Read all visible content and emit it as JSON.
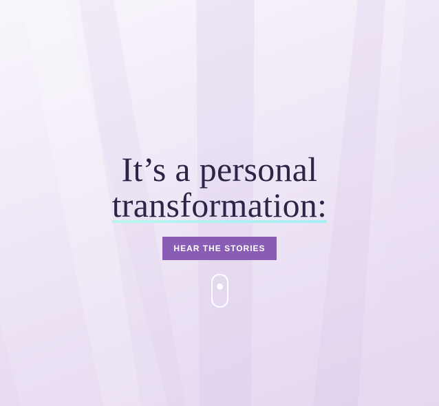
{
  "hero": {
    "headline_line1": "It’s a personal",
    "headline_line2": "transformation:",
    "cta_label": "HEAR THE STORIES"
  },
  "colors": {
    "heading": "#2b2546",
    "button_bg": "#8a5db5",
    "button_text": "#ffffff",
    "highlight_underline": "#b8f5ef"
  },
  "icons": {
    "scroll": "scroll-mouse-icon"
  }
}
